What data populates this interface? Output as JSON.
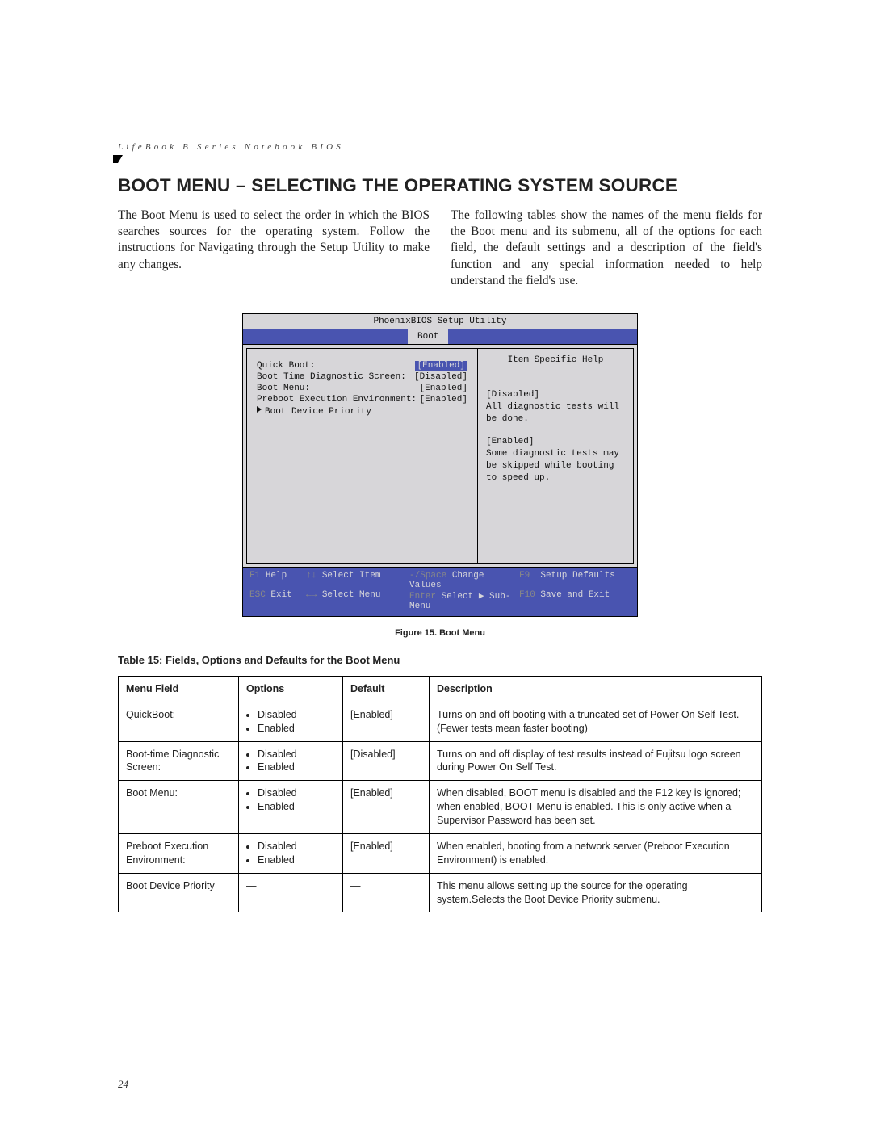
{
  "header_running": "LifeBook B Series Notebook BIOS",
  "title": "BOOT MENU – SELECTING THE OPERATING SYSTEM SOURCE",
  "intro_left": "The Boot Menu is used to select the order in which the BIOS searches sources for the operating system. Follow the instructions for Navigating through the Setup Utility to make any changes.",
  "intro_right": "The following tables show the names of the menu fields for the Boot menu and its submenu, all of the options for each field, the default settings and a description of the field's function and any special information needed to help understand the field's use.",
  "bios": {
    "util_title": "PhoenixBIOS Setup Utility",
    "active_tab": "Boot",
    "rows": {
      "r0_label": "Quick Boot:",
      "r0_value": "[Enabled]",
      "r1_label": "Boot Time Diagnostic Screen:",
      "r1_value": "[Disabled]",
      "r2_label": "Boot Menu:",
      "r2_value": "[Enabled]",
      "r3_label": "Preboot Execution Environment:",
      "r3_value": "[Enabled]",
      "r4_label": "Boot Device Priority"
    },
    "help": {
      "title": "Item Specific Help",
      "p1": "[Disabled]\nAll diagnostic tests will be done.",
      "p2": "[Enabled]\nSome diagnostic tests may be skipped while booting to speed up."
    },
    "footer": {
      "f1": "F1",
      "help": "Help",
      "arrows_v": "↑↓",
      "sel_item": "Select Item",
      "minus": "-/Space",
      "chg": "Change Values",
      "f9": "F9",
      "defaults": "Setup Defaults",
      "esc": "ESC",
      "exit": "Exit",
      "arrows_h": "←→",
      "sel_menu": "Select Menu",
      "enter": "Enter",
      "sub": "Select ▶ Sub-Menu",
      "f10": "F10",
      "save": "Save and Exit"
    }
  },
  "figure_caption": "Figure 15.  Boot Menu",
  "table_caption": "Table 15: Fields, Options and Defaults for the Boot Menu",
  "table": {
    "h0": "Menu Field",
    "h1": "Options",
    "h2": "Default",
    "h3": "Description",
    "rows": [
      {
        "field": "QuickBoot:",
        "opts": [
          "Disabled",
          "Enabled"
        ],
        "def": "[Enabled]",
        "desc": "Turns on and off booting with a truncated set of Power On Self Test. (Fewer tests mean faster booting)"
      },
      {
        "field": "Boot-time Diagnostic Screen:",
        "opts": [
          "Disabled",
          "Enabled"
        ],
        "def": "[Disabled]",
        "desc": "Turns on and off display of test results instead of Fujitsu logo screen during Power On Self Test."
      },
      {
        "field": "Boot Menu:",
        "opts": [
          "Disabled",
          "Enabled"
        ],
        "def": "[Enabled]",
        "desc": "When disabled, BOOT menu is disabled and the F12 key is ignored; when enabled, BOOT Menu is enabled. This is only active when a Supervisor Password has been set."
      },
      {
        "field": "Preboot Execution Environment:",
        "opts": [
          "Disabled",
          "Enabled"
        ],
        "def": "[Enabled]",
        "desc": "When enabled, booting from a network server (Preboot Execution Environment) is enabled."
      },
      {
        "field": "Boot Device Priority",
        "opts": [],
        "def": "—",
        "desc": "This menu allows setting up the source for the operating system.Selects the Boot Device Priority submenu."
      }
    ]
  },
  "page_number": "24"
}
